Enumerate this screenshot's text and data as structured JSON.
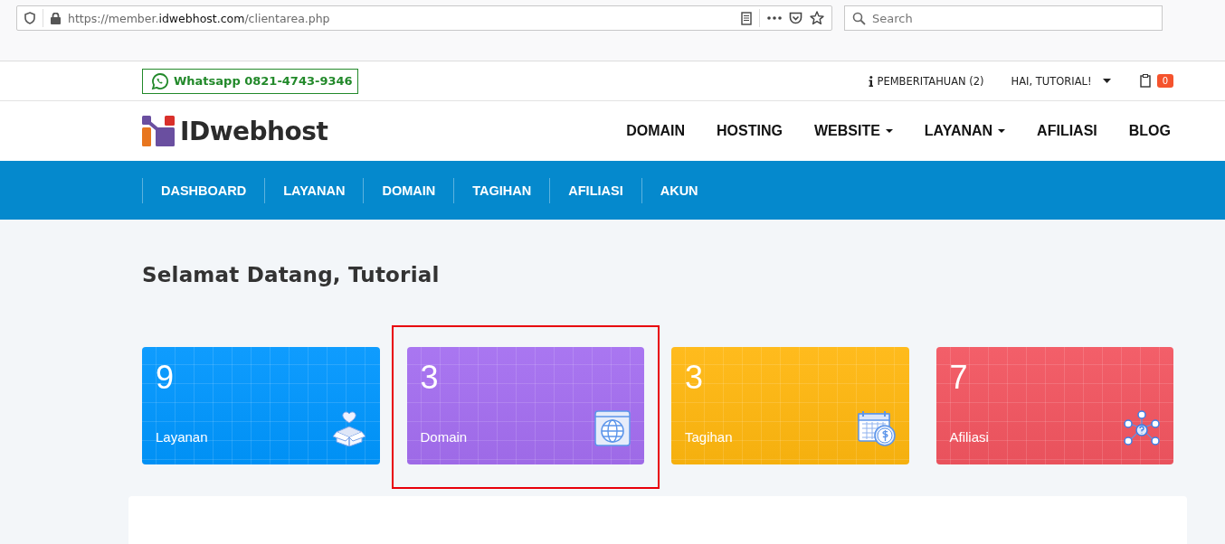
{
  "browser": {
    "url_prefix": "https://member.",
    "url_domain": "idwebhost.com",
    "url_path": "/clientarea.php",
    "search_placeholder": "Search"
  },
  "topbar": {
    "whatsapp": "Whatsapp 0821-4743-9346",
    "notifications": "PEMBERITAHUAN (2)",
    "user_menu": "HAI, TUTORIAL!",
    "cart_count": "0"
  },
  "header": {
    "logo_text": "IDwebhost",
    "menu": [
      {
        "label": "DOMAIN",
        "dropdown": false
      },
      {
        "label": "HOSTING",
        "dropdown": false
      },
      {
        "label": "WEBSITE",
        "dropdown": true
      },
      {
        "label": "LAYANAN",
        "dropdown": true
      },
      {
        "label": "AFILIASI",
        "dropdown": false
      },
      {
        "label": "BLOG",
        "dropdown": false
      }
    ]
  },
  "nav": [
    "DASHBOARD",
    "LAYANAN",
    "DOMAIN",
    "TAGIHAN",
    "AFILIASI",
    "AKUN"
  ],
  "welcome": "Selamat Datang, Tutorial",
  "cards": [
    {
      "count": "9",
      "label": "Layanan",
      "kind": "services",
      "color": "#0096fe",
      "highlighted": false
    },
    {
      "count": "3",
      "label": "Domain",
      "kind": "domain",
      "color": "#a46ef0",
      "highlighted": true
    },
    {
      "count": "3",
      "label": "Tagihan",
      "kind": "invoices",
      "color": "#ffb70f",
      "highlighted": false
    },
    {
      "count": "7",
      "label": "Afiliasi",
      "kind": "affiliates",
      "color": "#f25560",
      "highlighted": false
    }
  ]
}
